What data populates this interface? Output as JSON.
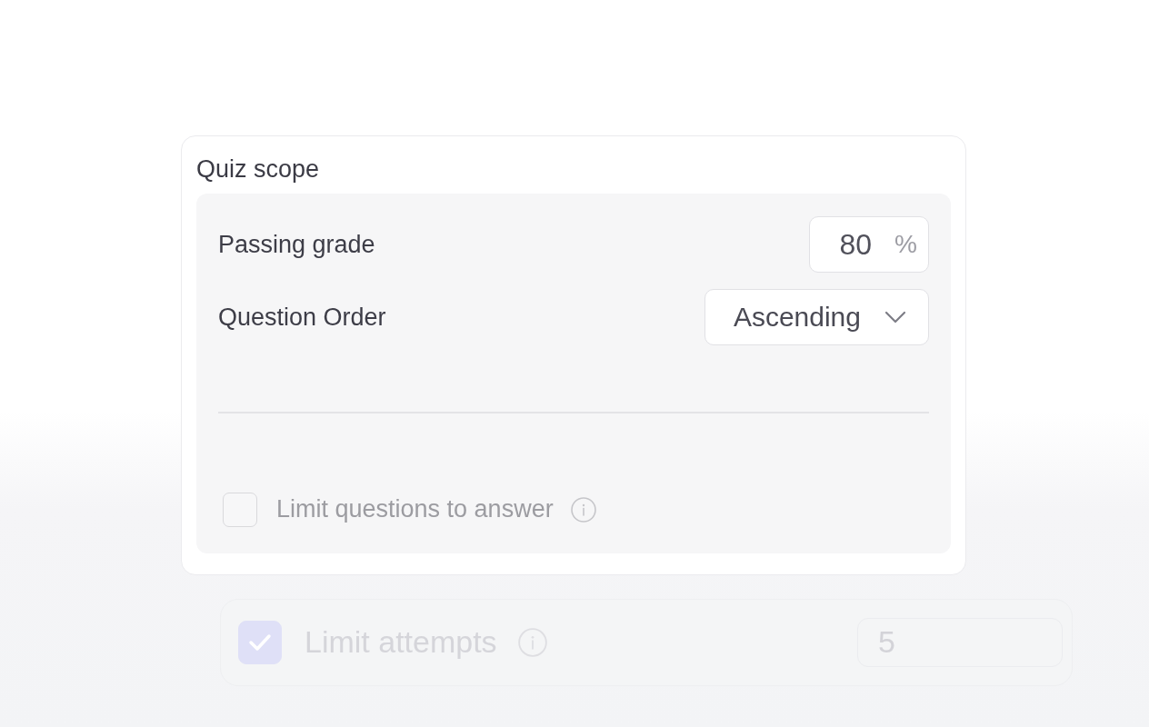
{
  "card": {
    "title": "Quiz scope",
    "fields": [
      {
        "kind": "number",
        "label": "Passing grade",
        "value": "80",
        "unit": "%"
      },
      {
        "kind": "select",
        "label": "Question Order",
        "value": "Ascending"
      }
    ],
    "options": [
      {
        "label": "Limit questions to answer",
        "checked": false,
        "disabled": true
      }
    ]
  },
  "next_card": {
    "rows": [
      {
        "label": "Limit attempts",
        "checked": true,
        "value": "5"
      }
    ]
  }
}
